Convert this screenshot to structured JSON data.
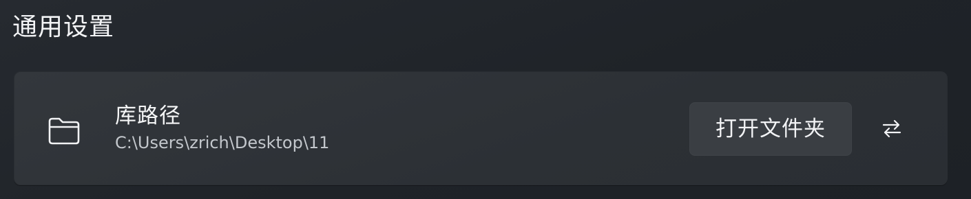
{
  "section": {
    "title": "通用设置"
  },
  "library_setting": {
    "icon": "folder-icon",
    "title": "库路径",
    "path": "C:\\Users\\zrich\\Desktop\\11",
    "open_folder_label": "打开文件夹",
    "swap_icon": "swap-arrows-icon"
  },
  "colors": {
    "background": "#1f2328",
    "card": "#2e3237",
    "button": "#3a3e43",
    "text_primary": "#f5f6f7",
    "text_secondary": "#c3c7cc"
  }
}
